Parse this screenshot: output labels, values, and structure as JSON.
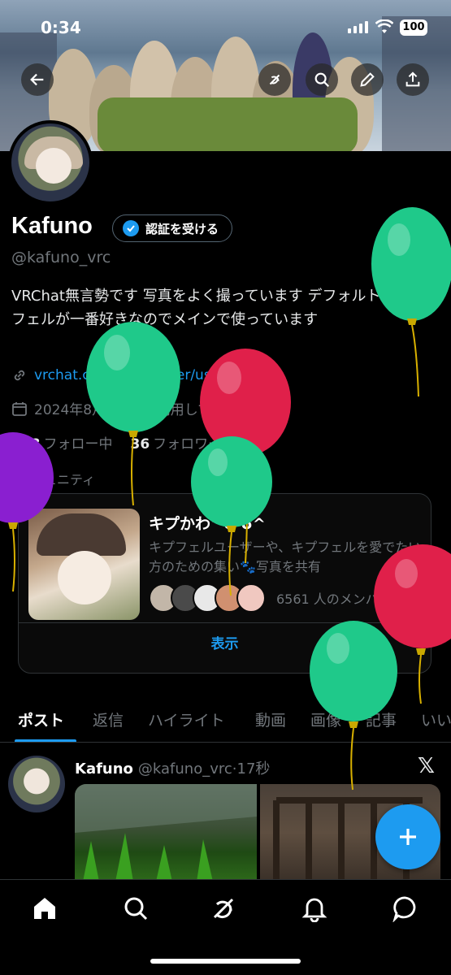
{
  "status_bar": {
    "time": "0:34",
    "battery": "100"
  },
  "profile": {
    "name": "Kafuno",
    "verify_button": "認証を受ける",
    "handle": "@kafuno_vrc",
    "bio": "VRChat無言勢です 写真をよく撮っています デフォルトのキプフェルが一番好きなのでメインで使っています",
    "link": "vrchat.com/home/user/usr_...",
    "joined": "2024年8月からXを利用しています",
    "following_count": "178",
    "following_label": "フォロー中",
    "followers_count": "36",
    "followers_label": "フォロワー"
  },
  "community": {
    "section_label": "コミュニティ",
    "title": "キプかわ^ʊ̈ ʊ̈^",
    "description": "キプフェルユーザーや、キプフェルを愛でたい方のための集い🐾写真を共有",
    "member_count": "6561 人のメンバー",
    "show_button": "表示"
  },
  "tabs": [
    "ポスト",
    "返信",
    "ハイライト",
    "動画",
    "画像",
    "記事",
    "いいね"
  ],
  "post": {
    "author": "Kafuno",
    "handle": "@kafuno_vrc",
    "time": "17秒"
  },
  "icons": {
    "back": "back-arrow-icon",
    "grok": "grok-icon",
    "search": "search-icon",
    "edit": "edit-icon",
    "share": "share-icon",
    "compose": "plus-icon"
  },
  "colors": {
    "accent": "#1d9bf0",
    "balloon_green": "#1fc98a",
    "balloon_red": "#e0204a",
    "balloon_purple": "#8a1fd0"
  }
}
